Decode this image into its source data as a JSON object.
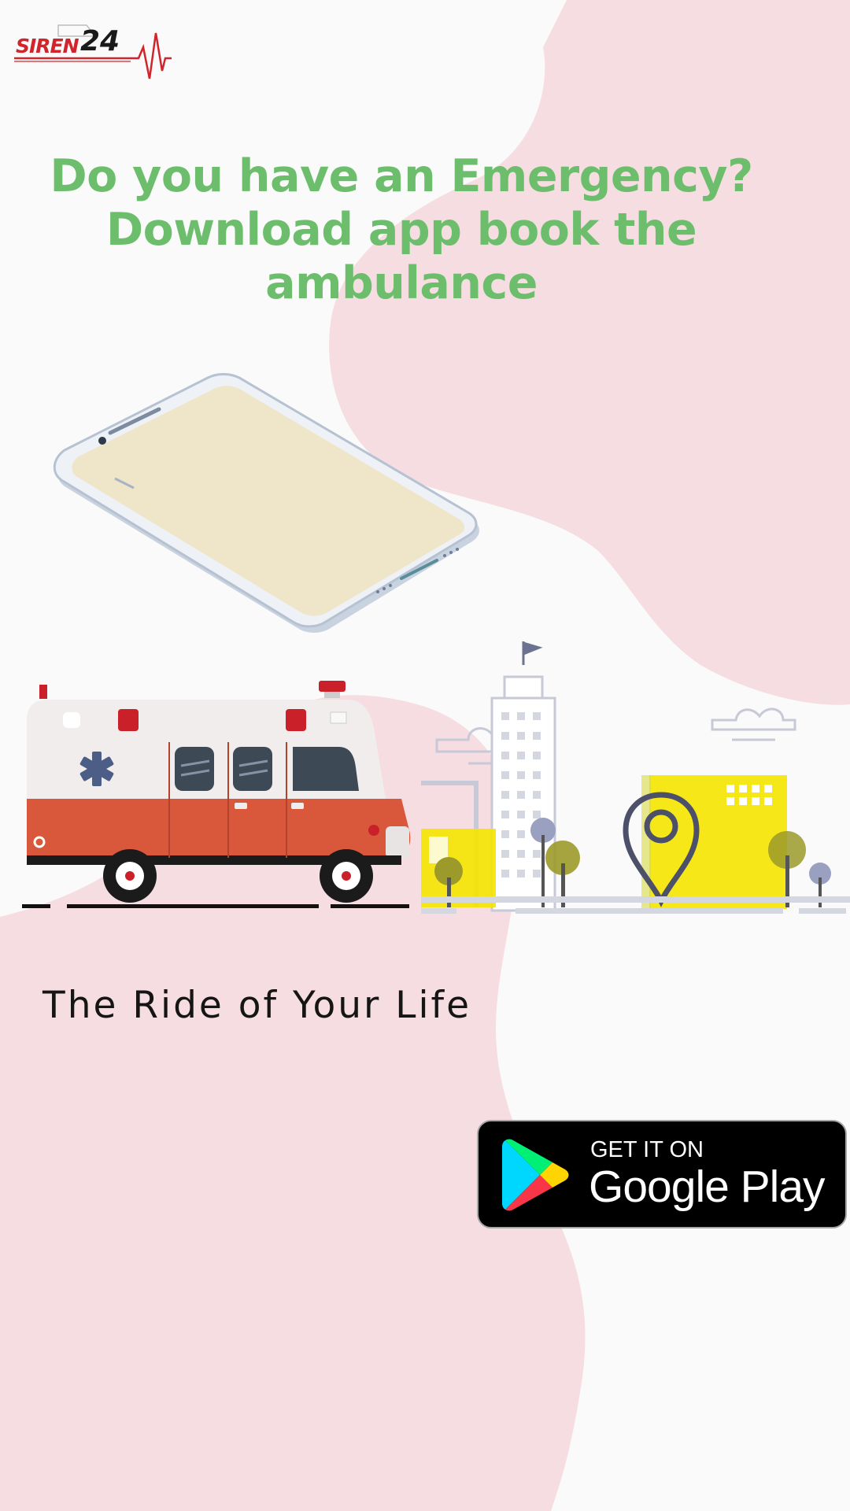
{
  "brand": {
    "logo_text": "SIREN",
    "logo_number": "24",
    "logo_icon": "ambulance-heartbeat-icon",
    "color": "#d1242b"
  },
  "headline": {
    "lines": [
      "Do you have an Emergency?",
      "Download app book the",
      "ambulance"
    ],
    "color": "#6cbe6c"
  },
  "illustrations": {
    "phone": "smartphone-icon",
    "ambulance": "ambulance-icon",
    "city": "city-location-pin-icon"
  },
  "tagline": "The Ride of Your Life",
  "store_badge": {
    "small_text": "GET IT ON",
    "big_text": "Google Play",
    "icon": "google-play-icon"
  },
  "colors": {
    "background": "#fbfafa",
    "blob": "#f5dde1",
    "ambulance_red": "#d9573a",
    "city_yellow": "#f5e400"
  }
}
